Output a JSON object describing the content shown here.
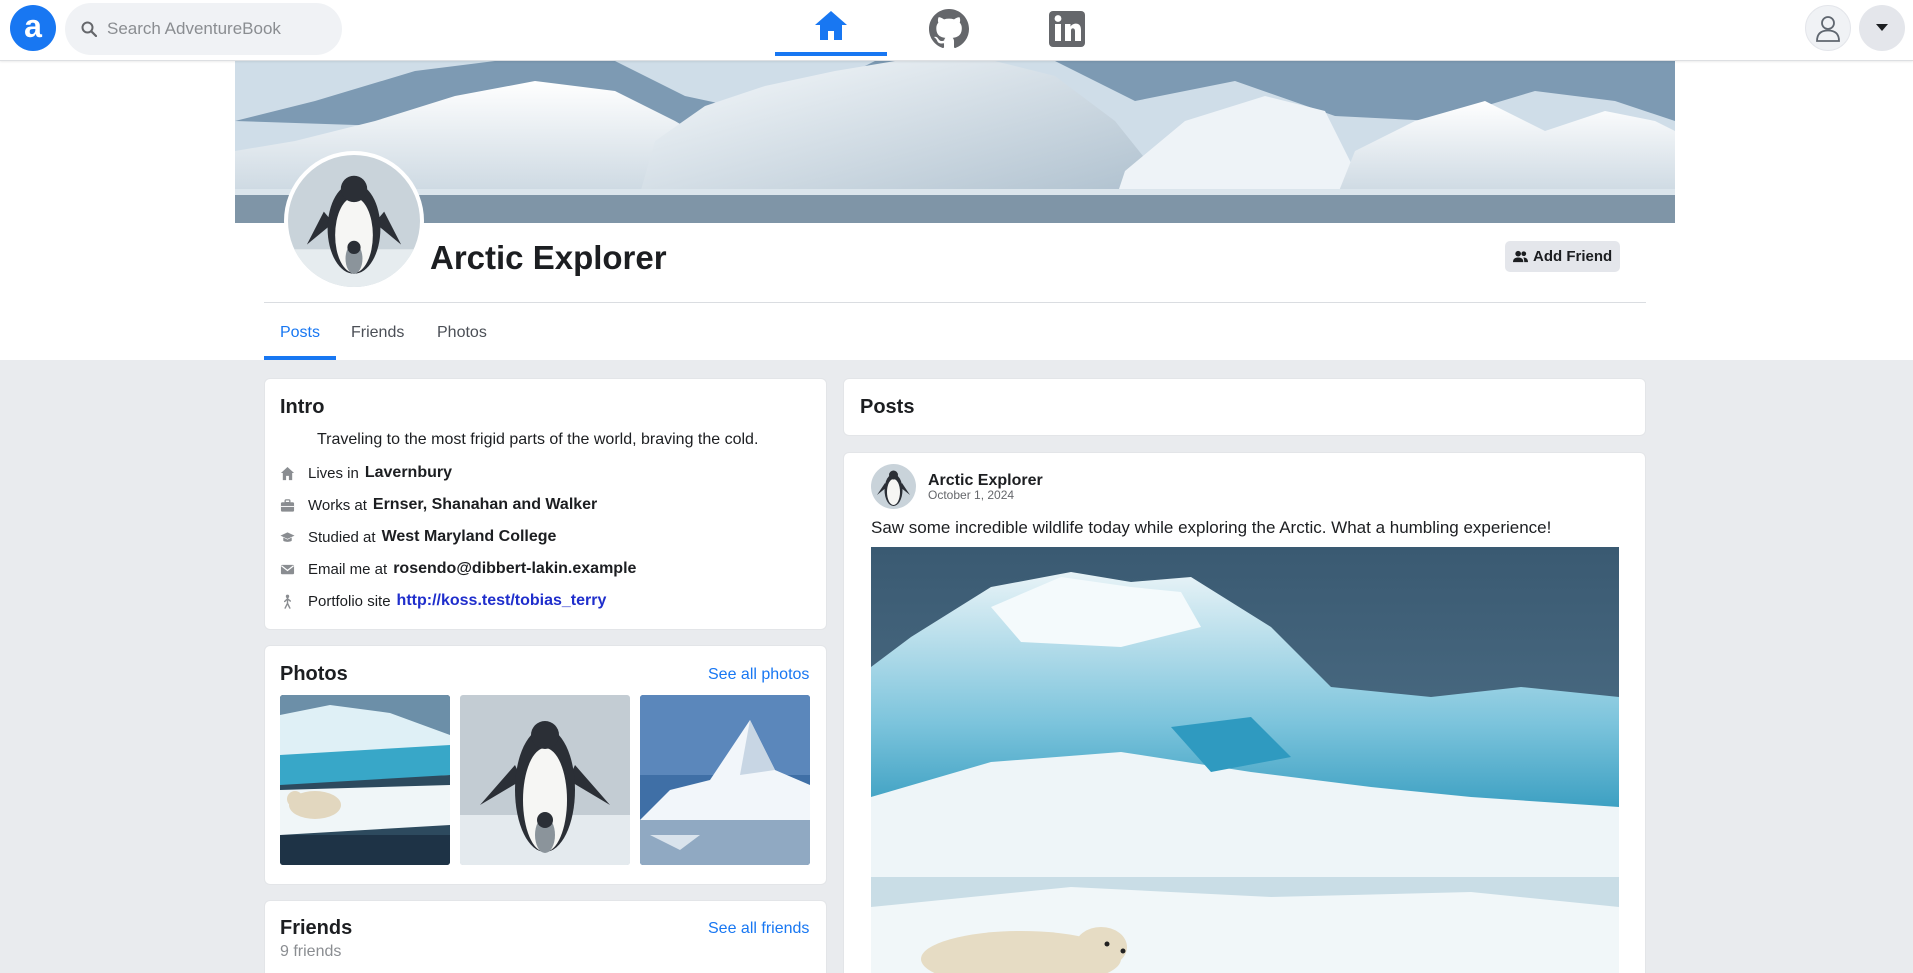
{
  "nav": {
    "logo_letter": "a",
    "search_placeholder": "Search AdventureBook",
    "tabs": [
      "home-icon",
      "github-icon",
      "linkedin-icon"
    ],
    "accent": "#1877f2"
  },
  "profile": {
    "name": "Arctic Explorer",
    "add_friend_label": "Add Friend",
    "tabs": [
      {
        "label": "Posts",
        "active": true
      },
      {
        "label": "Friends",
        "active": false
      },
      {
        "label": "Photos",
        "active": false
      }
    ]
  },
  "intro": {
    "title": "Intro",
    "bio": "Traveling to the most frigid parts of the world, braving the cold.",
    "rows": [
      {
        "icon": "home-icon",
        "label": "Lives in",
        "value": "Lavernbury"
      },
      {
        "icon": "briefcase-icon",
        "label": "Works at",
        "value": "Ernser, Shanahan and Walker"
      },
      {
        "icon": "graduation-cap-icon",
        "label": "Studied at",
        "value": "West Maryland College"
      },
      {
        "icon": "envelope-icon",
        "label": "Email me at",
        "value": "rosendo@dibbert-lakin.example"
      },
      {
        "icon": "person-icon",
        "label": "Portfolio site",
        "value": "http://koss.test/tobias_terry"
      }
    ]
  },
  "photos": {
    "title": "Photos",
    "see_all": "See all photos"
  },
  "friends": {
    "title": "Friends",
    "see_all": "See all friends",
    "count": "9 friends"
  },
  "posts": {
    "header": "Posts",
    "items": [
      {
        "author": "Arctic Explorer",
        "date": "October 1, 2024",
        "text": "Saw some incredible wildlife today while exploring the Arctic. What a humbling experience!"
      }
    ]
  }
}
